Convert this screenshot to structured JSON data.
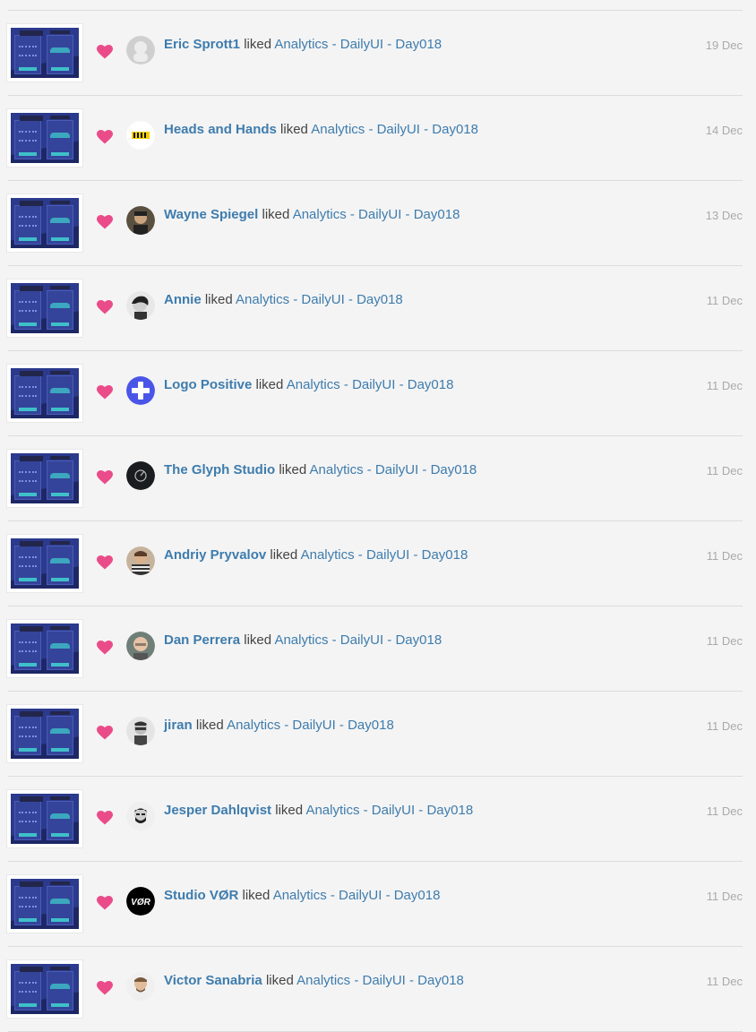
{
  "activity": [
    {
      "user": "Eric Sprott1",
      "action": "liked",
      "shot": "Analytics - DailyUI - Day018",
      "date": "19 Dec",
      "avatar": "default-avatar"
    },
    {
      "user": "Heads and Hands",
      "action": "liked",
      "shot": "Analytics - DailyUI - Day018",
      "date": "14 Dec",
      "avatar": "heads-and-hands-logo"
    },
    {
      "user": "Wayne Spiegel",
      "action": "liked",
      "shot": "Analytics - DailyUI - Day018",
      "date": "13 Dec",
      "avatar": "photo"
    },
    {
      "user": "Annie",
      "action": "liked",
      "shot": "Analytics - DailyUI - Day018",
      "date": "11 Dec",
      "avatar": "photo"
    },
    {
      "user": "Logo Positive",
      "action": "liked",
      "shot": "Analytics - DailyUI - Day018",
      "date": "11 Dec",
      "avatar": "plus-logo"
    },
    {
      "user": "The Glyph Studio",
      "action": "liked",
      "shot": "Analytics - DailyUI - Day018",
      "date": "11 Dec",
      "avatar": "glyph-logo"
    },
    {
      "user": "Andriy Pryvalov",
      "action": "liked",
      "shot": "Analytics - DailyUI - Day018",
      "date": "11 Dec",
      "avatar": "photo"
    },
    {
      "user": "Dan Perrera",
      "action": "liked",
      "shot": "Analytics - DailyUI - Day018",
      "date": "11 Dec",
      "avatar": "photo"
    },
    {
      "user": "jiran",
      "action": "liked",
      "shot": "Analytics - DailyUI - Day018",
      "date": "11 Dec",
      "avatar": "photo"
    },
    {
      "user": "Jesper Dahlqvist",
      "action": "liked",
      "shot": "Analytics - DailyUI - Day018",
      "date": "11 Dec",
      "avatar": "photo"
    },
    {
      "user": "Studio VØR",
      "action": "liked",
      "shot": "Analytics - DailyUI - Day018",
      "date": "11 Dec",
      "avatar": "vor-logo",
      "avatar_text": "VØR"
    },
    {
      "user": "Victor Sanabria",
      "action": "liked",
      "shot": "Analytics - DailyUI - Day018",
      "date": "11 Dec",
      "avatar": "photo"
    }
  ],
  "colors": {
    "link": "#3e7cad",
    "heart": "#ea4c89",
    "date": "#aaaaaa",
    "background": "#f4f4f4"
  }
}
